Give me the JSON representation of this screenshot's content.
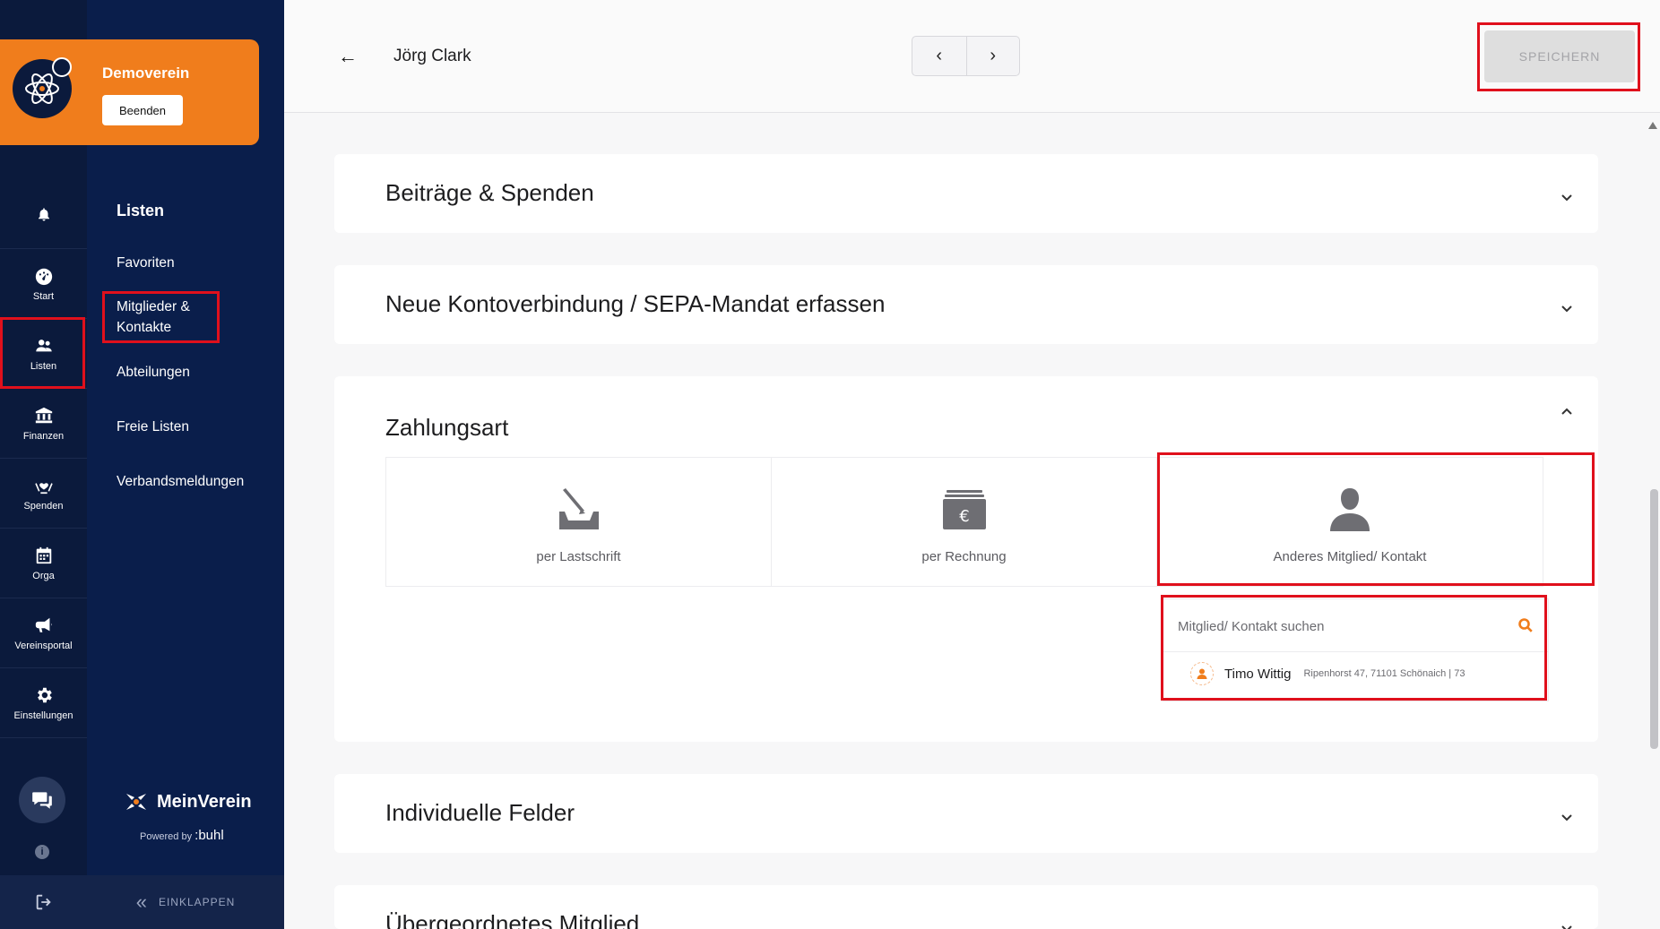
{
  "org": {
    "name": "Demoverein",
    "end_button": "Beenden"
  },
  "rail": {
    "items": [
      {
        "label": "Start",
        "icon": "dashboard-icon"
      },
      {
        "label": "Listen",
        "icon": "users-icon"
      },
      {
        "label": "Finanzen",
        "icon": "bank-icon"
      },
      {
        "label": "Spenden",
        "icon": "donation-icon"
      },
      {
        "label": "Orga",
        "icon": "calendar-icon"
      },
      {
        "label": "Vereinsportal",
        "icon": "megaphone-icon"
      },
      {
        "label": "Einstellungen",
        "icon": "gear-icon"
      }
    ],
    "info_glyph": "i"
  },
  "panel": {
    "title": "Listen",
    "links": [
      "Favoriten",
      "Mitglieder & Kontakte",
      "Abteilungen",
      "Freie Listen",
      "Verbandsmeldungen"
    ],
    "brand": "MeinVerein",
    "powered_by": "Powered by",
    "powered_brand": ":buhl",
    "collapse": "EINKLAPPEN"
  },
  "header": {
    "back_glyph": "←",
    "person_name": "Jörg Clark",
    "prev_glyph": "‹",
    "next_glyph": "›",
    "save_label": "SPEICHERN"
  },
  "sections": {
    "contributions": "Beiträge & Spenden",
    "bank": "Neue Kontoverbindung / SEPA-Mandat erfassen",
    "payment": "Zahlungsart",
    "custom_fields": "Individuelle Felder",
    "parent_member": "Übergeordnetes Mitglied"
  },
  "payment": {
    "options": [
      {
        "label": "per Lastschrift",
        "icon": "signature-icon"
      },
      {
        "label": "per Rechnung",
        "icon": "invoice-icon"
      },
      {
        "label": "Anderes Mitglied/ Kontakt",
        "icon": "person-icon"
      }
    ],
    "search_placeholder": "Mitglied/ Kontakt suchen",
    "result": {
      "name": "Timo Wittig",
      "address": "Ripenhorst 47, 71101 Schönaich | 73"
    }
  },
  "colors": {
    "accent": "#f07d1c",
    "nav": "#0a1e4b",
    "highlight": "#e0101c"
  }
}
